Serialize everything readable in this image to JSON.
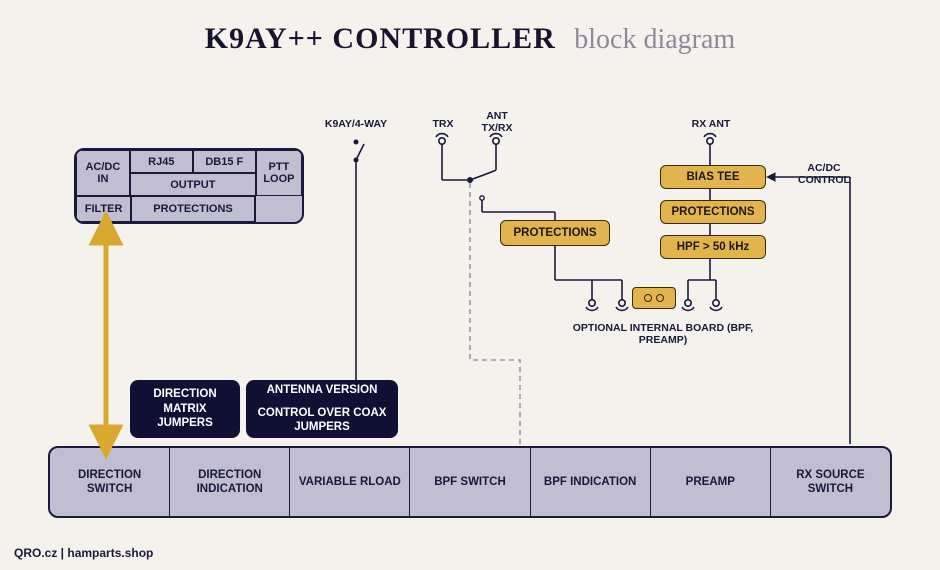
{
  "title": {
    "main": "K9AY++ CONTROLLER",
    "sub": "block diagram"
  },
  "top_left_box": {
    "acdc_in": "AC/DC IN",
    "rj45": "RJ45",
    "db15": "DB15 F",
    "output": "OUTPUT",
    "ptt_loop": "PTT LOOP",
    "filter": "FILTER",
    "protections": "PROTECTIONS"
  },
  "jumper_boxes": {
    "direction_matrix": "DIRECTION MATRIX JUMPERS",
    "antenna_version": "ANTENNA VERSION",
    "control_over_coax": "CONTROL OVER COAX JUMPERS"
  },
  "bottom_bus": [
    "DIRECTION SWITCH",
    "DIRECTION INDICATION",
    "VARIABLE RLOAD",
    "BPF SWITCH",
    "BPF INDICATION",
    "PREAMP",
    "RX SOURCE SWITCH"
  ],
  "yellow_blocks": {
    "protections_left": "PROTECTIONS",
    "bias_tee": "BIAS TEE",
    "protections_right": "PROTECTIONS",
    "hpf": "HPF > 50 kHz"
  },
  "labels": {
    "k9ay_4way": "K9AY/4-WAY",
    "trx": "TRX",
    "ant_txrx": "ANT TX/RX",
    "rx_ant": "RX ANT",
    "acdc_control": "AC/DC CONTROL",
    "optional_board": "OPTIONAL INTERNAL BOARD (BPF, PREAMP)"
  },
  "footer": "QRO.cz | hamparts.shop",
  "colors": {
    "bg": "#f5f2ee",
    "dark": "#0f1034",
    "purple_box": "#c1bed1",
    "stroke": "#181a3a",
    "yellow": "#e2b44e",
    "arrow": "#d9a82f"
  }
}
